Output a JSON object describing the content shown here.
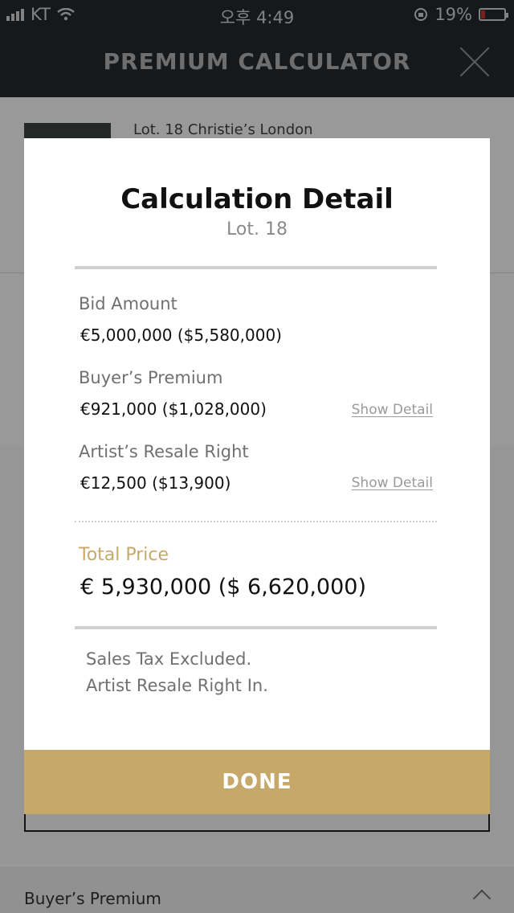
{
  "status_bar": {
    "carrier": "KT",
    "time": "오후 4:49",
    "battery_percent": "19%",
    "battery_level": 0.19
  },
  "nav": {
    "title": "PREMIUM CALCULATOR",
    "close_icon": "close-icon"
  },
  "background": {
    "lot_caption": "Lot. 18 Christie’s London",
    "section_label": "Buyer’s Premium"
  },
  "modal": {
    "title": "Calculation Detail",
    "subtitle": "Lot. 18",
    "bid_amount": {
      "label": "Bid Amount",
      "value": "€5,000,000 ($5,580,000)"
    },
    "buyers_premium": {
      "label": "Buyer’s Premium",
      "value": "€921,000 ($1,028,000)",
      "link": "Show Detail"
    },
    "resale_right": {
      "label": "Artist’s Resale Right",
      "value": "€12,500 ($13,900)",
      "link": "Show Detail"
    },
    "total": {
      "label": "Total Price",
      "value": "€ 5,930,000 ($ 6,620,000)"
    },
    "notes": [
      "Sales Tax Excluded.",
      "Artist Resale Right In."
    ],
    "done_label": "DONE"
  },
  "colors": {
    "accent_gold": "#c6a86a",
    "nav_dark": "#262a30"
  }
}
